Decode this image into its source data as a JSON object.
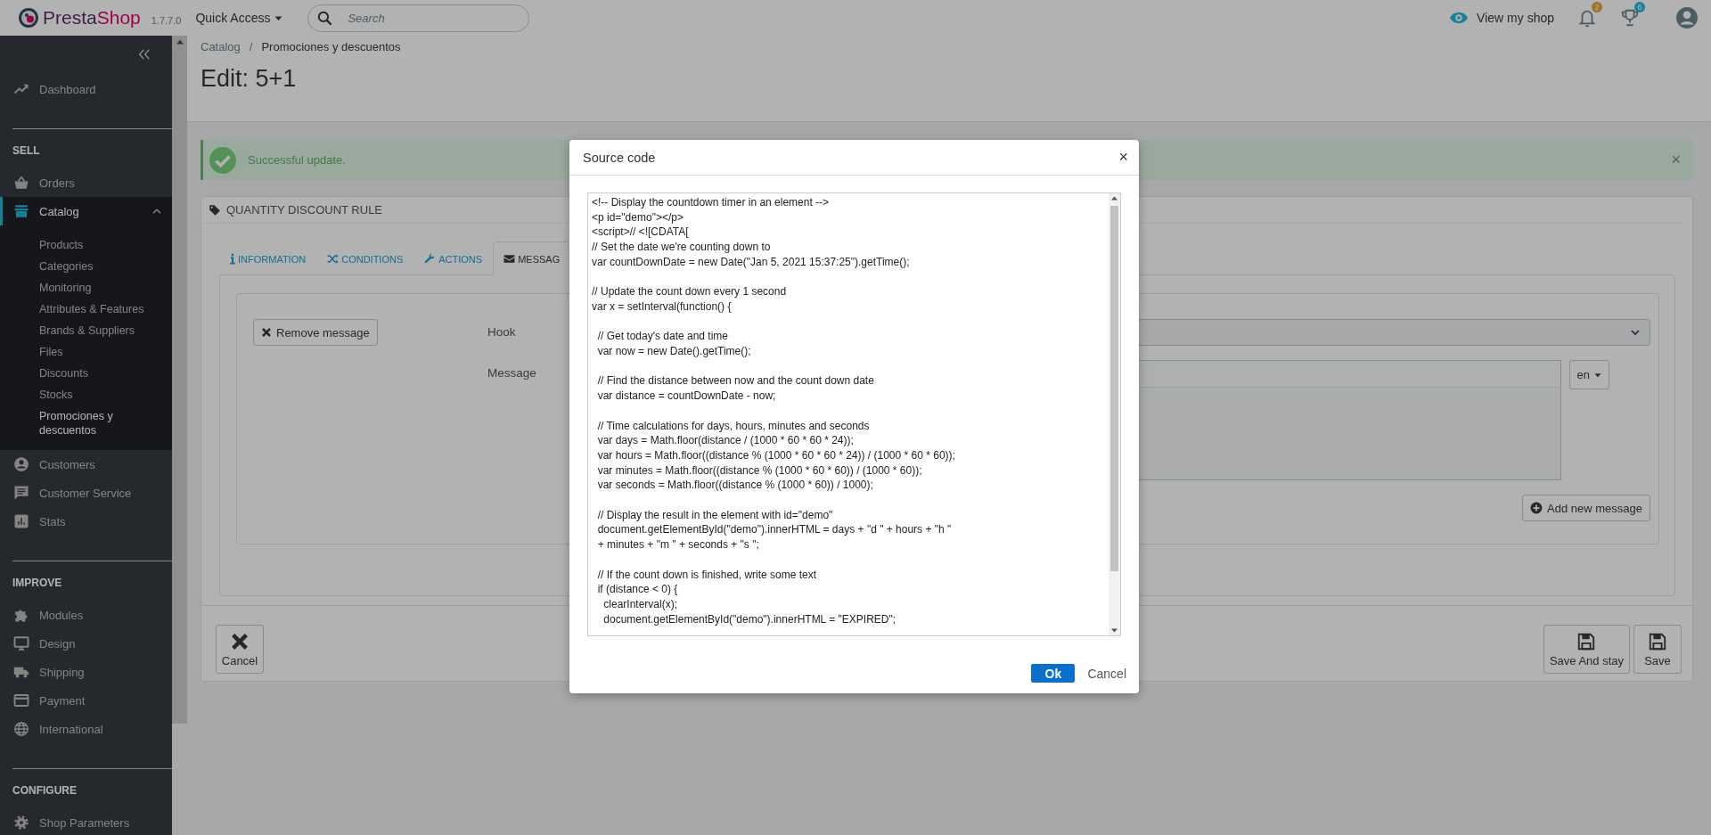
{
  "header": {
    "logo": "PrestaShop",
    "version": "1.7.7.0",
    "quick_access": "Quick Access",
    "search": {
      "placeholder": "Search"
    },
    "view_shop": "View my shop",
    "notifications": [
      {
        "count": "2",
        "color": "#a1712a"
      },
      {
        "count": "6",
        "color": "#1a8297"
      }
    ]
  },
  "sidebar": {
    "sections": [
      {
        "items": [
          {
            "label": "Dashboard",
            "selected": false,
            "expanded": false
          }
        ]
      },
      {
        "title": "SELL",
        "items": [
          {
            "label": "Orders",
            "selected": false,
            "expanded": false
          },
          {
            "label": "Catalog",
            "selected": true,
            "expanded": true,
            "children": [
              {
                "label": "Products",
                "selected": false
              },
              {
                "label": "Categories",
                "selected": false
              },
              {
                "label": "Monitoring",
                "selected": false
              },
              {
                "label": "Attributes & Features",
                "selected": false
              },
              {
                "label": "Brands & Suppliers",
                "selected": false
              },
              {
                "label": "Files",
                "selected": false
              },
              {
                "label": "Discounts",
                "selected": false
              },
              {
                "label": "Stocks",
                "selected": false
              },
              {
                "label": "Promociones y descuentos",
                "selected": true
              }
            ]
          },
          {
            "label": "Customers",
            "selected": false,
            "expanded": false
          },
          {
            "label": "Customer Service",
            "selected": false,
            "expanded": false
          },
          {
            "label": "Stats",
            "selected": false,
            "expanded": false
          }
        ]
      },
      {
        "title": "IMPROVE",
        "items": [
          {
            "label": "Modules",
            "selected": false,
            "expanded": false
          },
          {
            "label": "Design",
            "selected": false,
            "expanded": false
          },
          {
            "label": "Shipping",
            "selected": false,
            "expanded": false
          },
          {
            "label": "Payment",
            "selected": false,
            "expanded": false
          },
          {
            "label": "International",
            "selected": false,
            "expanded": false
          }
        ]
      },
      {
        "title": "CONFIGURE",
        "items": [
          {
            "label": "Shop Parameters",
            "selected": false,
            "expanded": false
          }
        ]
      }
    ]
  },
  "breadcrumb": {
    "items": [
      "Catalog",
      "Promociones y descuentos"
    ],
    "separator": "/"
  },
  "page_title": "Edit: 5+1",
  "alert": {
    "message": "Successful update.",
    "close": "×"
  },
  "card": {
    "title": "QUANTITY DISCOUNT RULE",
    "tabs": [
      {
        "label": "INFORMATION",
        "selected": false
      },
      {
        "label": "CONDITIONS",
        "selected": false
      },
      {
        "label": "ACTIONS",
        "selected": false
      },
      {
        "label": "MESSAG",
        "selected": true
      }
    ],
    "message_panel": {
      "remove_button": "Remove message",
      "hook_label": "Hook",
      "message_label": "Message",
      "language": "en",
      "add_button": "Add new message"
    },
    "footer": {
      "cancel": "Cancel",
      "save_and_stay": "Save And stay",
      "save": "Save"
    }
  },
  "modal": {
    "title": "Source code",
    "close": "×",
    "code": "<!-- Display the countdown timer in an element -->\n<p id=\"demo\"></p>\n<script>// <![CDATA[\n// Set the date we're counting down to\nvar countDownDate = new Date(\"Jan 5, 2021 15:37:25\").getTime();\n\n// Update the count down every 1 second\nvar x = setInterval(function() {\n\n  // Get today's date and time\n  var now = new Date().getTime();\n\n  // Find the distance between now and the count down date\n  var distance = countDownDate - now;\n\n  // Time calculations for days, hours, minutes and seconds\n  var days = Math.floor(distance / (1000 * 60 * 60 * 24));\n  var hours = Math.floor((distance % (1000 * 60 * 60 * 24)) / (1000 * 60 * 60));\n  var minutes = Math.floor((distance % (1000 * 60 * 60)) / (1000 * 60));\n  var seconds = Math.floor((distance % (1000 * 60)) / 1000);\n\n  // Display the result in the element with id=\"demo\"\n  document.getElementById(\"demo\").innerHTML = days + \"d \" + hours + \"h \"\n  + minutes + \"m \" + seconds + \"s \";\n\n  // If the count down is finished, write some text\n  if (distance < 0) {\n    clearInterval(x);\n    document.getElementById(\"demo\").innerHTML = \"EXPIRED\";",
    "ok": "Ok",
    "cancel": "Cancel"
  }
}
